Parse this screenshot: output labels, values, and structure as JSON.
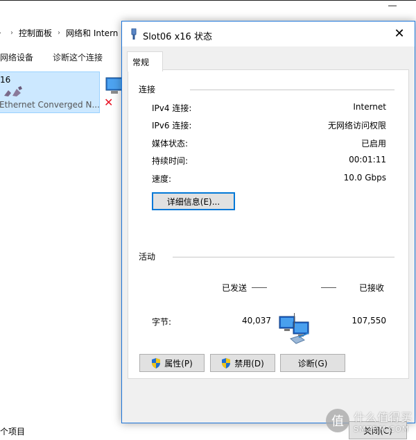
{
  "explorer": {
    "breadcrumb": [
      "控制面板",
      "网络和 Intern"
    ],
    "commands": [
      "网络设备",
      "诊断这个连接"
    ],
    "adapter": {
      "name": "16",
      "description": "Ethernet Converged N..."
    },
    "status_bar": "个项目"
  },
  "watermark": {
    "brand_cn": "什么值得买",
    "brand_en": "SMZDM.COM",
    "logo_glyph": "值"
  },
  "dialog": {
    "title": "Slot06 x16 状态",
    "close_glyph": "✕",
    "tab": "常规",
    "connection": {
      "heading": "连接",
      "rows": [
        {
          "label": "IPv4 连接:",
          "value": "Internet"
        },
        {
          "label": "IPv6 连接:",
          "value": "无网络访问权限"
        },
        {
          "label": "媒体状态:",
          "value": "已启用"
        },
        {
          "label": "持续时间:",
          "value": "00:01:11"
        },
        {
          "label": "速度:",
          "value": "10.0 Gbps"
        }
      ],
      "details_button": "详细信息(E)..."
    },
    "activity": {
      "heading": "活动",
      "sent_label": "已发送",
      "received_label": "已接收",
      "bytes_label": "字节:",
      "bytes_sent": "40,037",
      "bytes_received": "107,550"
    },
    "buttons": {
      "properties": "属性(P)",
      "disable": "禁用(D)",
      "diagnose": "诊断(G)",
      "close": "关闭(C)"
    }
  },
  "colors": {
    "accent": "#0078d7",
    "selection": "#cce8ff",
    "error_red": "#e81123"
  }
}
